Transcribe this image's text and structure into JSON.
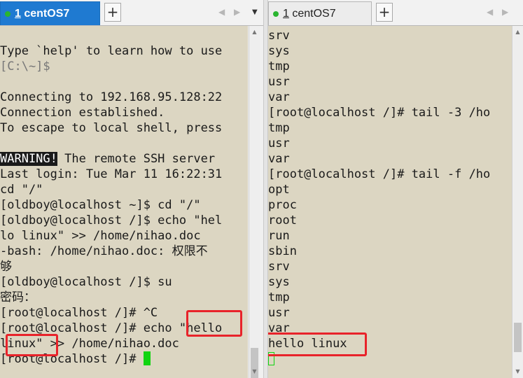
{
  "left": {
    "tab": {
      "number": "1",
      "title": "centOS7"
    },
    "add_label": "+",
    "nav_prev": "◀",
    "nav_next": "▶",
    "lines": [
      [],
      [
        {
          "t": "Type `help' to learn how to use"
        }
      ],
      [
        {
          "t": "[C:\\~]$",
          "dim": true
        }
      ],
      [],
      [
        {
          "t": "Connecting to 192.168.95.128:22"
        }
      ],
      [
        {
          "t": "Connection established."
        }
      ],
      [
        {
          "t": "To escape to local shell, press"
        }
      ],
      [],
      [
        {
          "t": "WARNING!",
          "warn": true
        },
        {
          "t": " The remote SSH server"
        }
      ],
      [
        {
          "t": "Last login: Tue Mar 11 16:22:31"
        }
      ],
      [
        {
          "t": "cd \"/\""
        }
      ],
      [
        {
          "t": "[oldboy@localhost ~]$ cd \"/\""
        }
      ],
      [
        {
          "t": "[oldboy@localhost /]$ echo \"hel"
        }
      ],
      [
        {
          "t": "lo linux\" >> /home/nihao.doc"
        }
      ],
      [
        {
          "t": "-bash: /home/nihao.doc: 权限不"
        }
      ],
      [
        {
          "t": "够"
        }
      ],
      [
        {
          "t": "[oldboy@localhost /]$ su"
        }
      ],
      [
        {
          "t": "密码："
        }
      ],
      [
        {
          "t": "[root@localhost /]# ^C"
        }
      ],
      [
        {
          "t": "[root@localhost /]# echo \"hello"
        }
      ],
      [
        {
          "t": "linux\" >> /home/nihao.doc"
        }
      ],
      [
        {
          "t": "[root@localhost /]# "
        },
        {
          "cursor": "solid"
        }
      ]
    ]
  },
  "right": {
    "tab": {
      "number": "1",
      "title": "centOS7"
    },
    "add_label": "+",
    "nav_prev": "◀",
    "nav_next": "▶",
    "dropdown": "▼",
    "lines": [
      [
        {
          "t": "srv"
        }
      ],
      [
        {
          "t": "sys"
        }
      ],
      [
        {
          "t": "tmp"
        }
      ],
      [
        {
          "t": "usr"
        }
      ],
      [
        {
          "t": "var"
        }
      ],
      [
        {
          "t": "[root@localhost /]# tail -3 /ho"
        }
      ],
      [
        {
          "t": "tmp"
        }
      ],
      [
        {
          "t": "usr"
        }
      ],
      [
        {
          "t": "var"
        }
      ],
      [
        {
          "t": "[root@localhost /]# tail -f /ho"
        }
      ],
      [
        {
          "t": "opt"
        }
      ],
      [
        {
          "t": "proc"
        }
      ],
      [
        {
          "t": "root"
        }
      ],
      [
        {
          "t": "run"
        }
      ],
      [
        {
          "t": "sbin"
        }
      ],
      [
        {
          "t": "srv"
        }
      ],
      [
        {
          "t": "sys"
        }
      ],
      [
        {
          "t": "tmp"
        }
      ],
      [
        {
          "t": "usr"
        }
      ],
      [
        {
          "t": "var"
        }
      ],
      [
        {
          "t": "hello linux"
        }
      ],
      [
        {
          "cursor": "hollow"
        }
      ]
    ]
  },
  "colors": {
    "terminal_bg": "#dcd6c2",
    "active_tab": "#1f7ad1",
    "status_dot": "#2ab530",
    "cursor": "#11d411",
    "highlight": "#e8232a"
  }
}
